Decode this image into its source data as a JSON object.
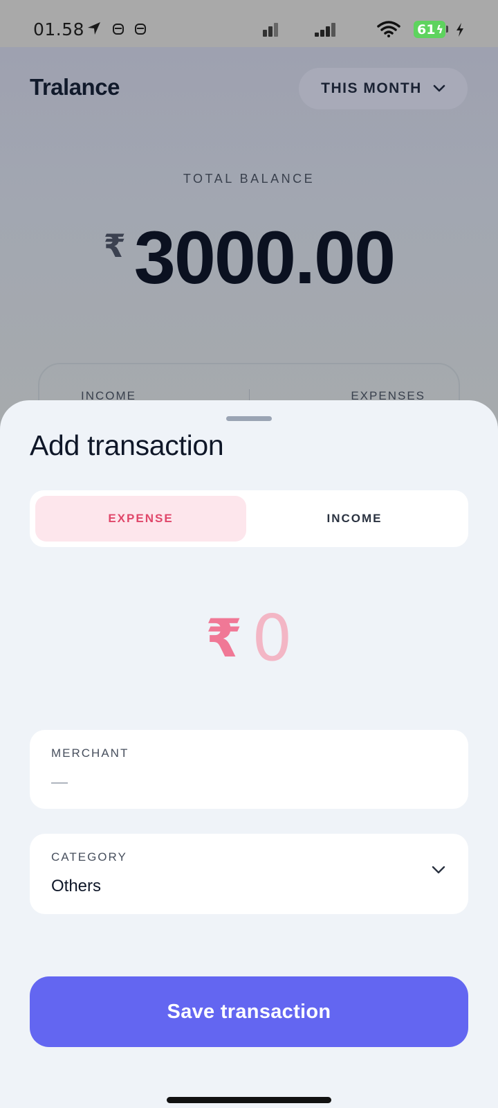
{
  "status_bar": {
    "time": "01.58",
    "battery": "61"
  },
  "header": {
    "app_title": "Tralance",
    "period_label": "THIS MONTH"
  },
  "balance": {
    "label": "TOTAL BALANCE",
    "currency": "₹",
    "amount": "3000.00"
  },
  "summary": {
    "income_label": "INCOME",
    "expenses_label": "EXPENSES"
  },
  "sheet": {
    "title": "Add transaction",
    "tabs": {
      "expense": "EXPENSE",
      "income": "INCOME",
      "selected": "expense"
    },
    "amount": {
      "currency": "₹",
      "value": "0"
    },
    "merchant": {
      "label": "MERCHANT",
      "placeholder": "—",
      "value": ""
    },
    "category": {
      "label": "CATEGORY",
      "value": "Others"
    },
    "save_label": "Save transaction"
  },
  "colors": {
    "accent": "#6366f1",
    "expense_text": "#e0476a",
    "expense_bg": "#fde6ec",
    "sheet_bg": "#eff3f8"
  },
  "icons": [
    "location-arrow-icon",
    "mask-icon",
    "signal-bars-icon",
    "wifi-icon",
    "battery-icon",
    "charging-icon",
    "chevron-down-icon",
    "grabber-handle"
  ]
}
